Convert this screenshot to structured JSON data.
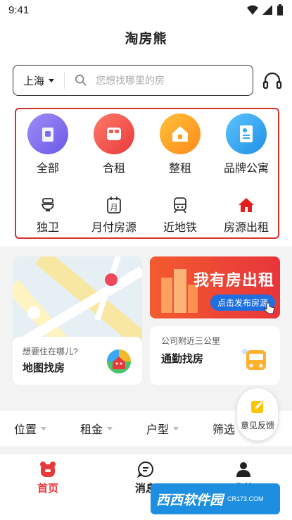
{
  "status": {
    "time": "9:41"
  },
  "app": {
    "title": "淘房熊"
  },
  "search": {
    "city": "上海",
    "placeholder": "您想找哪里的房"
  },
  "categories": [
    {
      "label": "全部",
      "icon": "building-icon",
      "color": "#7b6cf0"
    },
    {
      "label": "合租",
      "icon": "bed-icon",
      "color": "#f45b4f"
    },
    {
      "label": "整租",
      "icon": "house-icon",
      "color": "#ffa31a"
    },
    {
      "label": "品牌公寓",
      "icon": "document-icon",
      "color": "#3aa8f2"
    }
  ],
  "subcategories": [
    {
      "label": "独卫",
      "icon": "toilet-icon"
    },
    {
      "label": "月付房源",
      "icon": "calendar-month-icon"
    },
    {
      "label": "近地铁",
      "icon": "subway-icon"
    },
    {
      "label": "房源出租",
      "icon": "home-red-icon"
    }
  ],
  "map_card": {
    "subtitle": "想要住在哪儿?",
    "title": "地图找房"
  },
  "promo": {
    "title": "我有房出租",
    "button": "点击发布房源"
  },
  "commute": {
    "subtitle": "公司附近三公里",
    "title": "通勤找房"
  },
  "filters": [
    {
      "label": "位置"
    },
    {
      "label": "租金"
    },
    {
      "label": "户型"
    },
    {
      "label": "筛选"
    }
  ],
  "feedback": {
    "label": "意见反馈"
  },
  "tabs": [
    {
      "label": "首页",
      "active": true,
      "color": "#e8393a"
    },
    {
      "label": "消息",
      "active": false,
      "color": "#222222"
    },
    {
      "label": "我的",
      "active": false,
      "color": "#222222"
    }
  ],
  "watermark": {
    "text": "西西软件园",
    "sub": "CR173.COM"
  }
}
